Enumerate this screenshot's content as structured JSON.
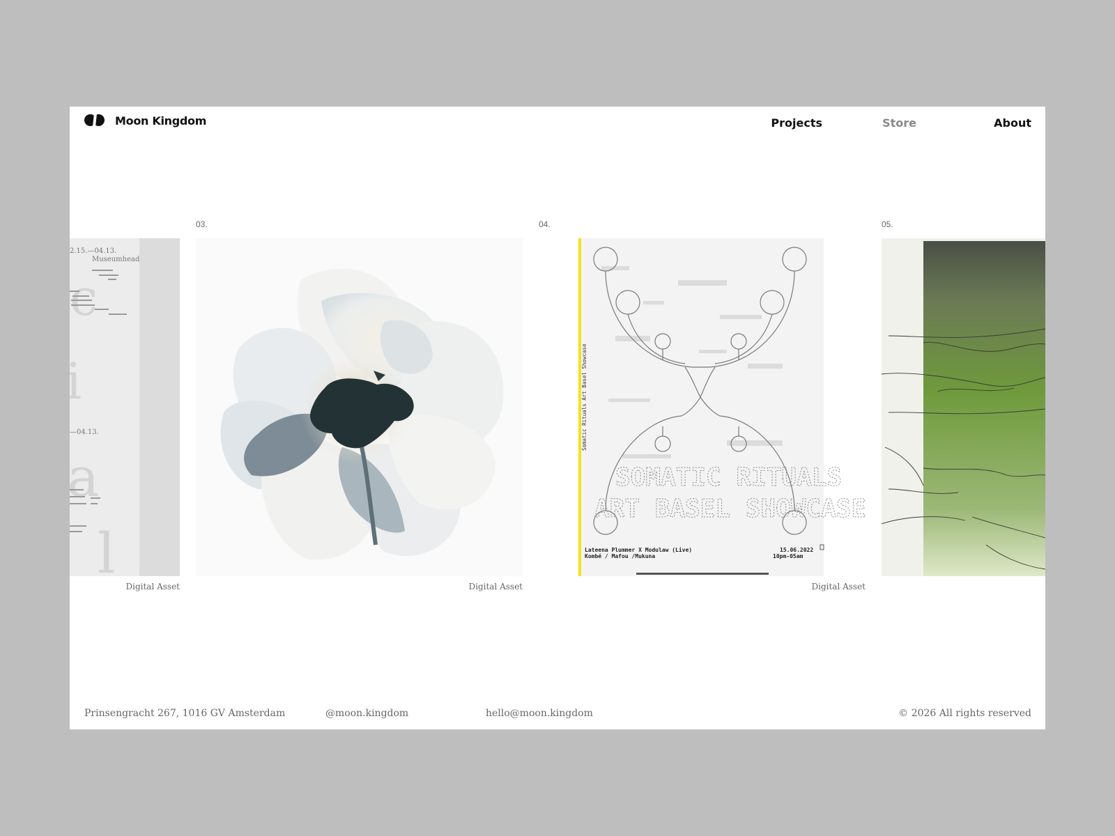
{
  "header": {
    "brand": "Moon Kingdom",
    "nav": [
      {
        "label": "Projects"
      },
      {
        "label": "Store"
      },
      {
        "label": "About"
      }
    ]
  },
  "cards": [
    {
      "number": "",
      "label": "Digital Asset",
      "poster_text": {
        "dates": "2.15.—04.13.",
        "venue": "Museumhead",
        "dates2": "—04.13."
      }
    },
    {
      "number": "03.",
      "label": "Digital Asset"
    },
    {
      "number": "04.",
      "label": "Digital Asset",
      "poster_text": {
        "side": "Somatic Rituals Art Basel Showcase",
        "performers": "Lateena Plummer X Modulaw (Live)",
        "performers2": "Kombé / Mafou /Mukuna",
        "date": "15.06.2022",
        "time": "10pm-05am"
      }
    },
    {
      "number": "05.",
      "label": ""
    }
  ],
  "footer": {
    "address": "Prinsengracht 267, 1016 GV Amsterdam",
    "instagram": "@moon.kingdom",
    "email": "hello@moon.kingdom",
    "copyright": "© 2026  All rights reserved"
  },
  "colors": {
    "background": "#bebebe",
    "page": "#ffffff",
    "text_dark": "#111111",
    "text_muted": "#666666",
    "nav_inactive": "#8a8a8a",
    "accent_yellow": "#f2e21b",
    "green": "#6f8f3a"
  }
}
